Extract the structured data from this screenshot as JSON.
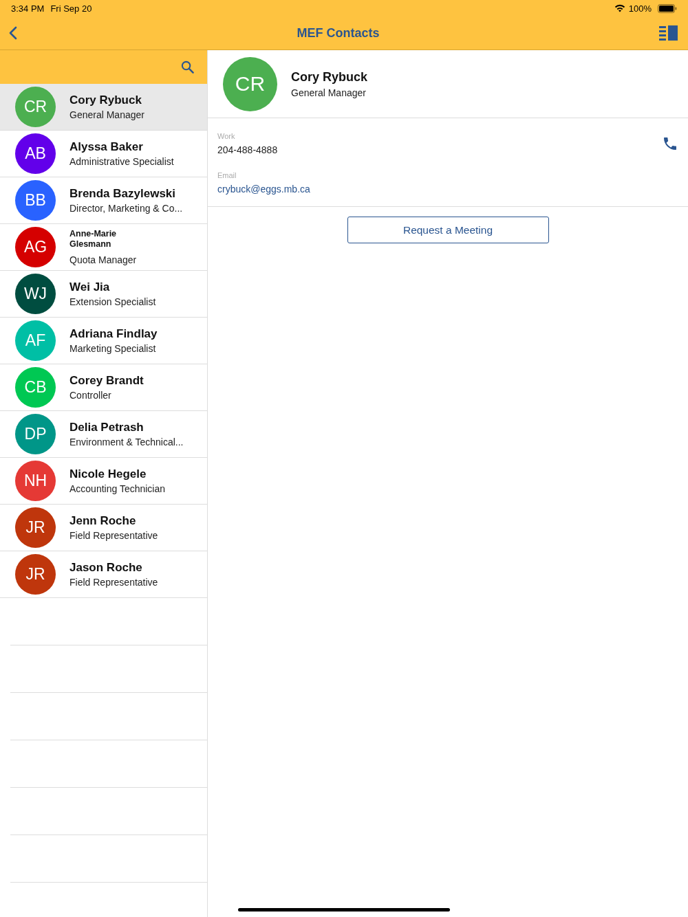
{
  "status_bar": {
    "time": "3:34 PM",
    "date": "Fri Sep 20",
    "battery": "100%"
  },
  "nav": {
    "title": "MEF Contacts"
  },
  "contacts": [
    {
      "initials": "CR",
      "name": "Cory Rybuck",
      "role": "General Manager",
      "color": "#4caf50",
      "selected": true,
      "kind": "normal"
    },
    {
      "initials": "AB",
      "name": "Alyssa Baker",
      "role": "Administrative Specialist",
      "color": "#6200ea",
      "selected": false,
      "kind": "normal"
    },
    {
      "initials": "BB",
      "name": "Brenda Bazylewski",
      "role": "Director,  Marketing & Co...",
      "color": "#2962ff",
      "selected": false,
      "kind": "normal"
    },
    {
      "initials": "AG",
      "name": "Anne-Marie Glesmann",
      "role": "Quota Manager",
      "color": "#d50000",
      "selected": false,
      "kind": "wrapped"
    },
    {
      "initials": "WJ",
      "name": "Wei Jia",
      "role": "Extension Specialist",
      "color": "#004d40",
      "selected": false,
      "kind": "normal"
    },
    {
      "initials": "AF",
      "name": "Adriana Findlay",
      "role": "Marketing Specialist",
      "color": "#00bfa5",
      "selected": false,
      "kind": "normal"
    },
    {
      "initials": "CB",
      "name": "Corey Brandt",
      "role": "Controller",
      "color": "#00c853",
      "selected": false,
      "kind": "normal"
    },
    {
      "initials": "DP",
      "name": "Delia Petrash",
      "role": "Environment & Technical...",
      "color": "#009688",
      "selected": false,
      "kind": "normal"
    },
    {
      "initials": "NH",
      "name": "Nicole Hegele",
      "role": "Accounting Technician",
      "color": "#e53935",
      "selected": false,
      "kind": "normal"
    },
    {
      "initials": "JR",
      "name": "Jenn Roche",
      "role": "Field Representative",
      "color": "#bf360c",
      "selected": false,
      "kind": "normal"
    },
    {
      "initials": "JR",
      "name": "Jason Roche",
      "role": "Field Representative",
      "color": "#bf360c",
      "selected": false,
      "kind": "normal"
    }
  ],
  "detail": {
    "initials": "CR",
    "name": "Cory Rybuck",
    "role": "General Manager",
    "color": "#4caf50",
    "fields": [
      {
        "label": "Work",
        "value": "204-488-4888",
        "kind": "phone"
      },
      {
        "label": "Email",
        "value": "crybuck@eggs.mb.ca",
        "kind": "email"
      }
    ],
    "button": "Request a Meeting"
  }
}
